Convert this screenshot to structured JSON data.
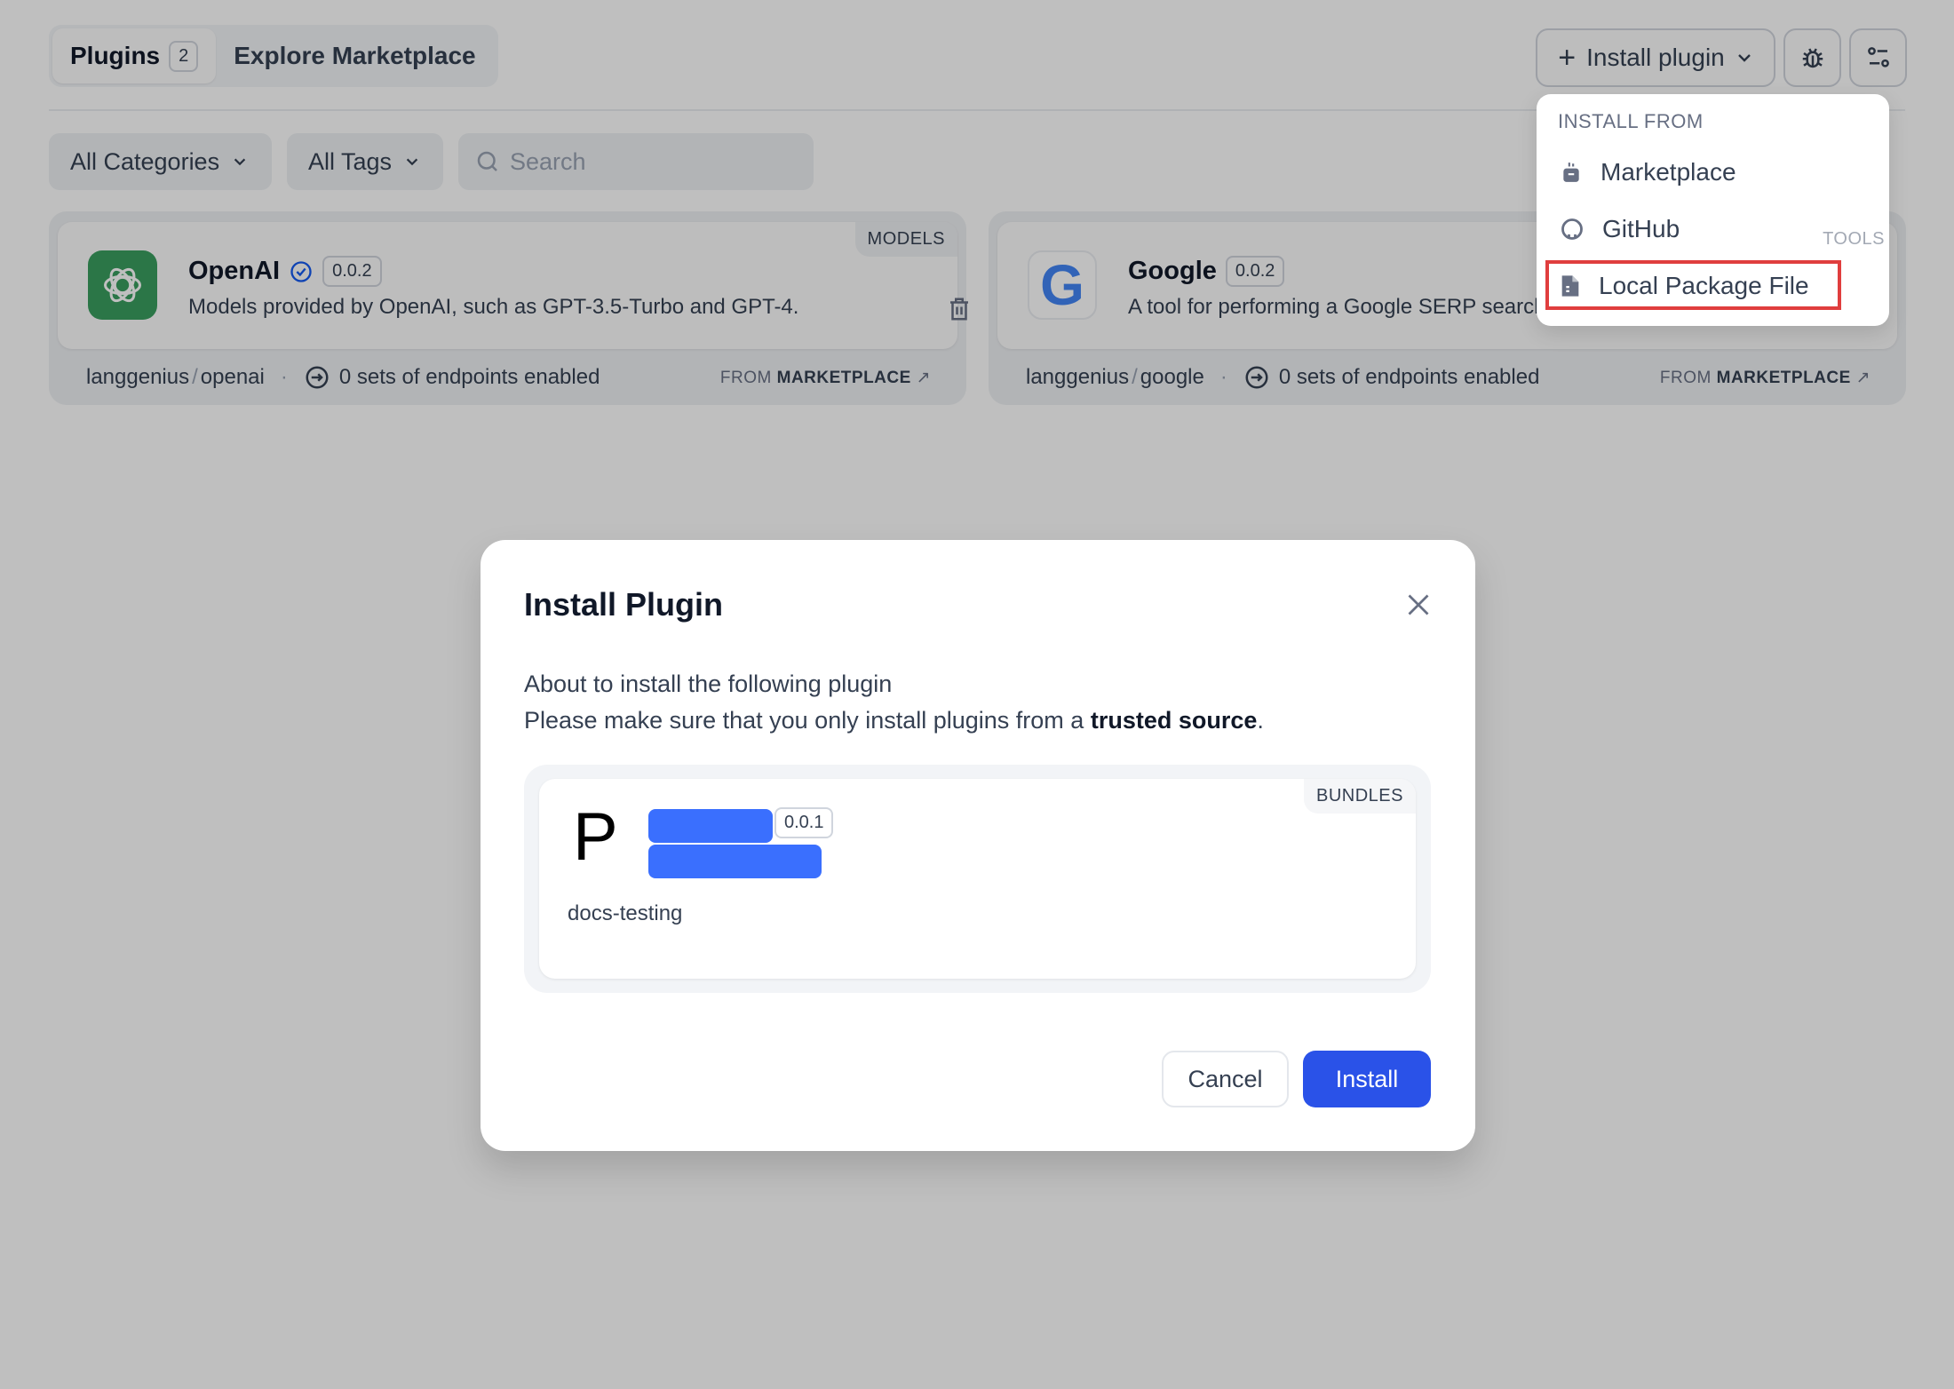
{
  "tabs": {
    "plugins": "Plugins",
    "plugins_count": "2",
    "explore": "Explore Marketplace"
  },
  "toolbar": {
    "install_plugin": "Install plugin",
    "debug_icon": "bug-icon",
    "settings_icon": "sliders-icon"
  },
  "filters": {
    "categories": "All Categories",
    "tags": "All Tags",
    "search_placeholder": "Search"
  },
  "plugins": [
    {
      "name": "OpenAI",
      "verified": true,
      "version": "0.0.2",
      "description": "Models provided by OpenAI, such as GPT-3.5-Turbo and GPT-4.",
      "category": "MODELS",
      "org": "langgenius",
      "slug": "openai",
      "endpoints": "0 sets of endpoints enabled",
      "from_label": "FROM",
      "from_source": "MARKETPLACE"
    },
    {
      "name": "Google",
      "verified": false,
      "version": "0.0.2",
      "description": "A tool for performing a Google SERP search and extracting snippets",
      "category": "TOOLS",
      "org": "langgenius",
      "slug": "google",
      "endpoints": "0 sets of endpoints enabled",
      "from_label": "FROM",
      "from_source": "MARKETPLACE"
    }
  ],
  "install_menu": {
    "header": "INSTALL FROM",
    "items": [
      {
        "label": "Marketplace",
        "icon": "marketplace-icon"
      },
      {
        "label": "GitHub",
        "icon": "github-icon"
      },
      {
        "label": "Local Package File",
        "icon": "file-package-icon",
        "highlighted": true
      }
    ]
  },
  "modal": {
    "title": "Install Plugin",
    "line1": "About to install the following plugin",
    "line2_prefix": "Please make sure that you only install plugins from a ",
    "line2_bold": "trusted source",
    "line2_suffix": ".",
    "plugin": {
      "icon_letter": "P",
      "version": "0.0.1",
      "category": "BUNDLES",
      "org": "docs-testing",
      "name_redacted": true
    },
    "cancel": "Cancel",
    "install": "Install"
  },
  "colors": {
    "accent": "#155aef",
    "redaction": "#3a6ffe",
    "highlight": "#e03e3e",
    "openai_green": "#3a9e5f"
  }
}
